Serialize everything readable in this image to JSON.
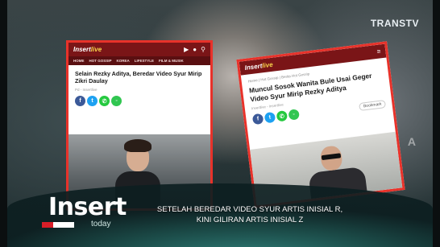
{
  "broadcast": {
    "channel_logo": "TRANSTV",
    "program": "Insert",
    "program_sub": "today",
    "headline_line1": "SETELAH BEREDAR VIDEO SYUR ARTIS INISIAL R,",
    "headline_line2": "KINI GILIRAN ARTIS INISIAL Z",
    "watermark": "A"
  },
  "card_left": {
    "site_logo": "Insertlive",
    "site_logo_accent": "live",
    "nav": [
      "HOME",
      "HOT GOSSIP",
      "KOREA",
      "LIFESTYLE",
      "FILM & MUSIK"
    ],
    "title": "Selain Rezky Aditya, Beredar Video Syur Mirip Zikri Daulay",
    "meta": "Pd - Insertlive"
  },
  "card_right": {
    "site_logo": "Insertlive",
    "crumb": "Home | Hot Gossip | Berita Hot Gossip",
    "title": "Muncul Sosok Wanita Bule Usai Geger Video Syur Mirip Rezky Aditya",
    "meta": "Insertlive - Insertlive",
    "bookmark": "Bookmark"
  },
  "icons": {
    "share": [
      "facebook-icon",
      "twitter-icon",
      "whatsapp-icon",
      "line-icon"
    ],
    "header": [
      "video-icon",
      "user-icon",
      "search-icon",
      "menu-icon"
    ]
  },
  "colors": {
    "card_border": "#e8322a",
    "site_header": "#7a1517",
    "lower_third": "#2e7c76"
  }
}
